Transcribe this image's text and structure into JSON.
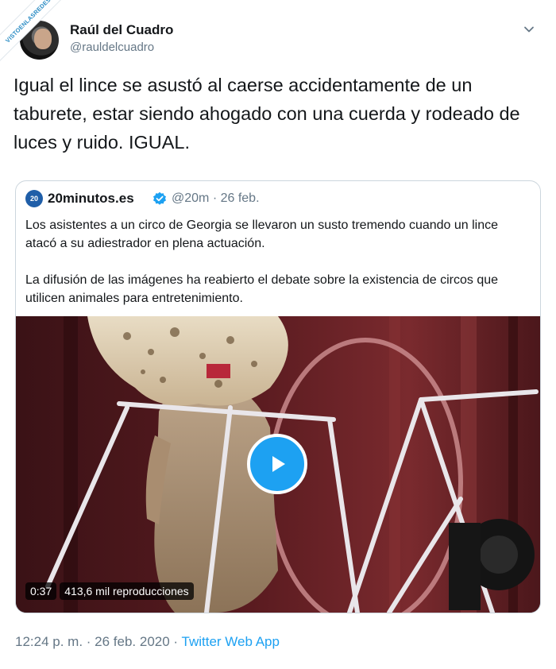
{
  "watermark": "VISTOENLASREDES",
  "author": {
    "name": "Raúl del Cuadro",
    "handle": "@rauldelcuadro"
  },
  "tweet": {
    "text": "Igual el lince se asustó al caerse accidentamente de un taburete, estar siendo ahogado con una cuerda y rodeado de luces y ruido. IGUAL."
  },
  "quoted": {
    "logo_text": "20",
    "name": "20minutos.es",
    "handle_date": "@20m · 26 feb.",
    "paragraph1": "Los asistentes a un circo de Georgia se llevaron un susto tremendo cuando un lince atacó a su adiestrador en plena actuación.",
    "paragraph2": "La difusión de las imágenes ha reabierto el debate sobre la existencia de circos que utilicen animales para entretenimiento.",
    "video": {
      "duration": "0:37",
      "views": "413,6 mil reproducciones"
    }
  },
  "footer": {
    "time_date": "12:24 p. m. · 26 feb. 2020 · ",
    "app": "Twitter Web App"
  },
  "colors": {
    "accent": "#1da1f2",
    "secondary_text": "#657786",
    "border": "#ccd6dd"
  }
}
